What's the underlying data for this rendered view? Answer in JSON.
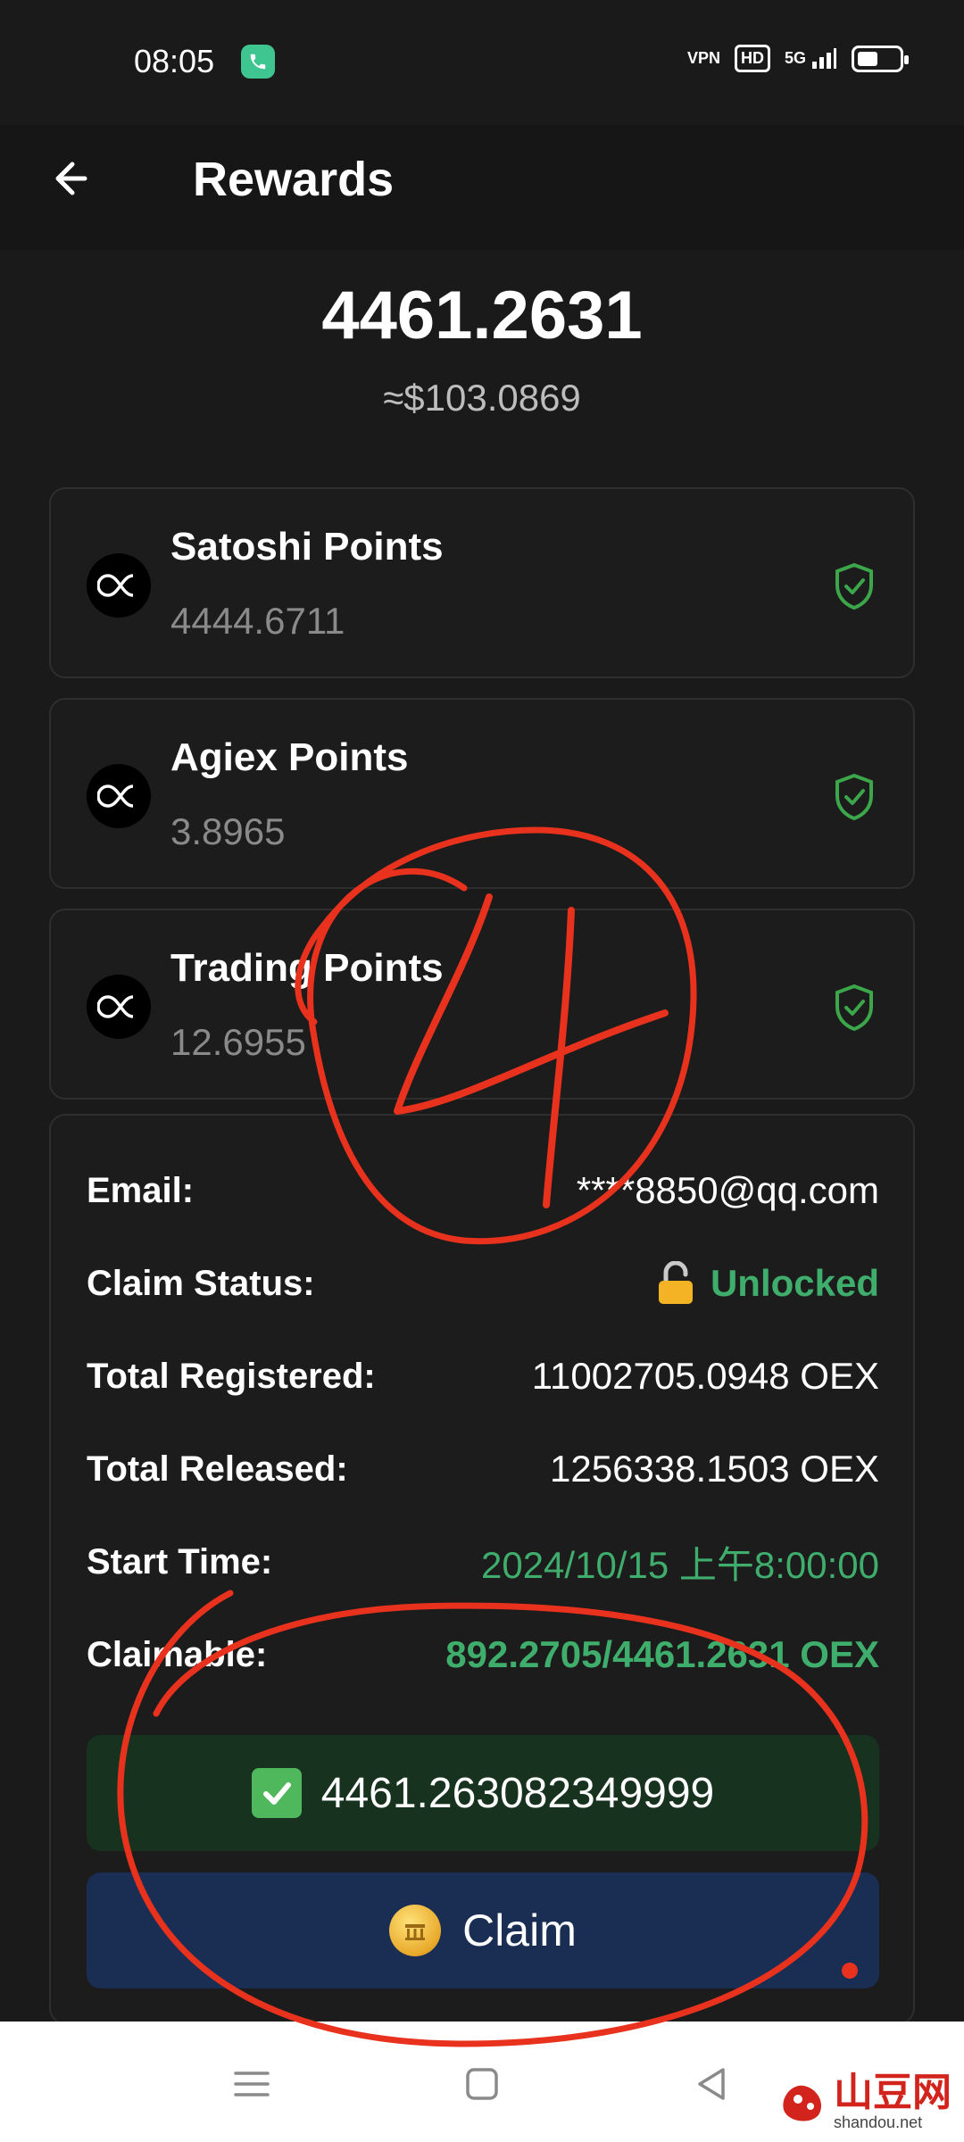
{
  "status_bar": {
    "time": "08:05",
    "icons": [
      "phone-call-icon",
      "vpn-icon",
      "hd-icon",
      "signal-5g-icon",
      "battery-icon"
    ],
    "vpn_label": "VPN",
    "hd_label": "HD",
    "network_label": "5G"
  },
  "header": {
    "title": "Rewards",
    "back_icon": "arrow-left-icon"
  },
  "summary": {
    "total_points": "4461.2631",
    "total_usd": "≈$103.0869"
  },
  "points": [
    {
      "name": "Satoshi Points",
      "value": "4444.6711",
      "icon": "oex-logo-icon",
      "status_icon": "shield-check-icon"
    },
    {
      "name": "Agiex Points",
      "value": "3.8965",
      "icon": "oex-logo-icon",
      "status_icon": "shield-check-icon"
    },
    {
      "name": "Trading Points",
      "value": "12.6955",
      "icon": "oex-logo-icon",
      "status_icon": "shield-check-icon"
    }
  ],
  "info": {
    "email_label": "Email:",
    "email_value": "****8850@qq.com",
    "claim_status_label": "Claim Status:",
    "claim_status_value": "Unlocked",
    "total_registered_label": "Total Registered:",
    "total_registered_value": "11002705.0948 OEX",
    "total_released_label": "Total Released:",
    "total_released_value": "1256338.1503 OEX",
    "start_time_label": "Start Time:",
    "start_time_value": "2024/10/15 上午8:00:00",
    "claimable_label": "Claimable:",
    "claimable_value": "892.2705/4461.2631 OEX"
  },
  "result": {
    "value": "4461.263082349999",
    "icon": "check-mark-icon"
  },
  "claim_button": {
    "label": "Claim",
    "icon": "coin-icon"
  },
  "nav_bar": {
    "icons": [
      "menu-icon",
      "home-icon",
      "back-triangle-icon"
    ]
  },
  "annotation": {
    "number": "4",
    "color": "#e8321e"
  },
  "watermark": {
    "text": "山豆网",
    "url": "shandou.net"
  },
  "colors": {
    "background": "#1a1a1a",
    "accent_green": "#3fae6c",
    "claim_blue": "#1a2d52",
    "result_green_bg": "#17321f",
    "pen_red": "#e8321e"
  }
}
